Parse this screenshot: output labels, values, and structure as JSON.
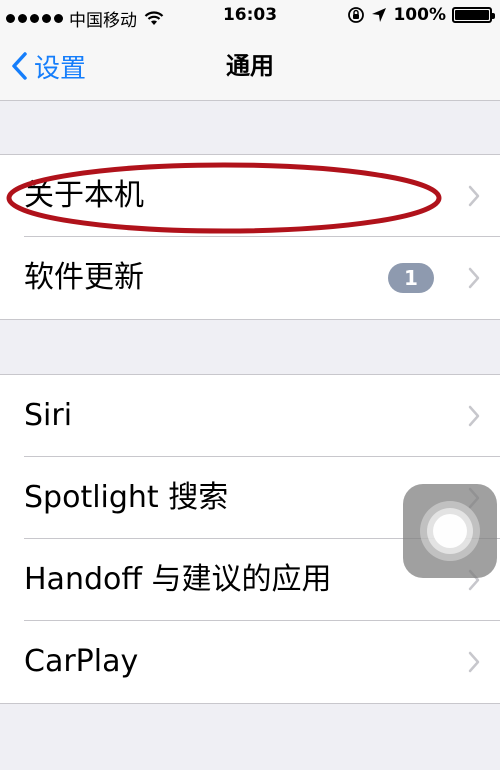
{
  "status_bar": {
    "carrier": "中国移动",
    "time": "16:03",
    "battery_text": "100%",
    "battery_level": 1.0,
    "icons": [
      "signal-dots-icon",
      "wifi-icon",
      "orientation-lock-icon",
      "location-arrow-icon",
      "battery-icon"
    ]
  },
  "nav": {
    "back_label": "设置",
    "title": "通用"
  },
  "groups": [
    {
      "rows": [
        {
          "label": "关于本机",
          "highlighted": true
        },
        {
          "label": "软件更新",
          "badge": "1"
        }
      ]
    },
    {
      "rows": [
        {
          "label": "Siri"
        },
        {
          "label": "Spotlight 搜索"
        },
        {
          "label": "Handoff 与建议的应用"
        },
        {
          "label": "CarPlay"
        }
      ]
    }
  ],
  "colors": {
    "accent": "#157efb",
    "background": "#efeff4",
    "badge": "#8e9aaf",
    "highlight_ellipse": "#b0121b",
    "chevron": "#c7c7cc"
  }
}
